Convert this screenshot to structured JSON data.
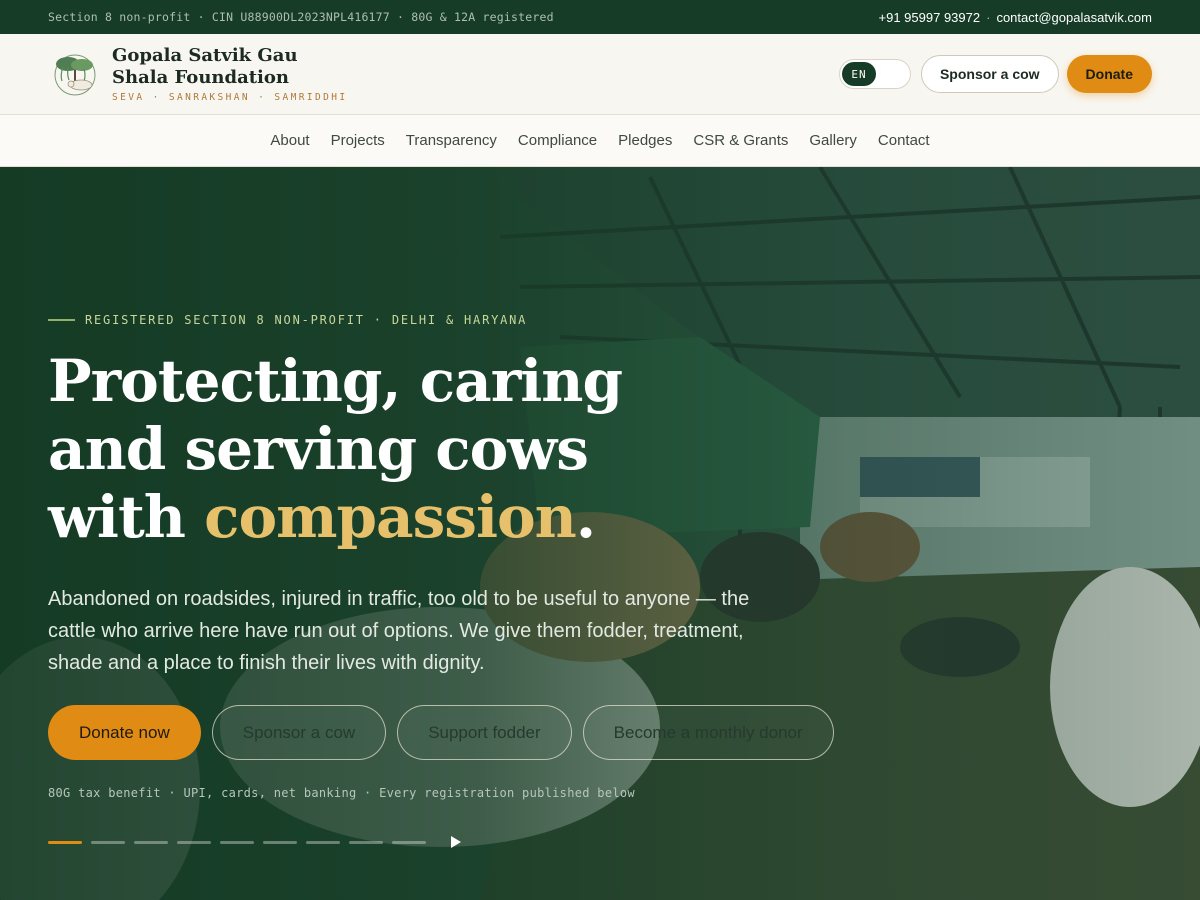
{
  "topbar": {
    "registration": "Section 8 non-profit · CIN U88900DL2023NPL416177 · 80G & 12A registered",
    "phone": "+91 95997 93972",
    "separator": "·",
    "email": "contact@gopalasatvik.com"
  },
  "header": {
    "brand_name": "Gopala Satvik Gau Shala Foundation",
    "tagline": "SEVA · SANRAKSHAN · SAMRIDDHI",
    "language": "EN",
    "sponsor_label": "Sponsor a cow",
    "donate_label": "Donate"
  },
  "nav": {
    "items": [
      "About",
      "Projects",
      "Transparency",
      "Compliance",
      "Pledges",
      "CSR & Grants",
      "Gallery",
      "Contact"
    ]
  },
  "hero": {
    "eyebrow": "REGISTERED SECTION 8 NON-PROFIT · DELHI & HARYANA",
    "headline_1": "Protecting, caring",
    "headline_2": "and serving cows",
    "headline_3_pre": "with ",
    "headline_accent": "compassion",
    "headline_end": ".",
    "lead": "Abandoned on roadsides, injured in traffic, too old to be useful to anyone — the cattle who arrive here have run out of options. We give them fodder, treatment, shade and a place to finish their lives with dignity.",
    "cta_donate": "Donate now",
    "cta_sponsor": "Sponsor a cow",
    "cta_fodder": "Support fodder",
    "cta_monthly": "Become a monthly donor",
    "fineprint": "80G tax benefit · UPI, cards, net banking · Every registration published below",
    "slides_total": 9,
    "slide_active": 1
  },
  "colors": {
    "primary_green": "#163b26",
    "accent_orange": "#e08b14",
    "gold": "#e6c06a"
  },
  "icons": {
    "logo": "cow-under-tree-logo",
    "play": "play-icon"
  }
}
